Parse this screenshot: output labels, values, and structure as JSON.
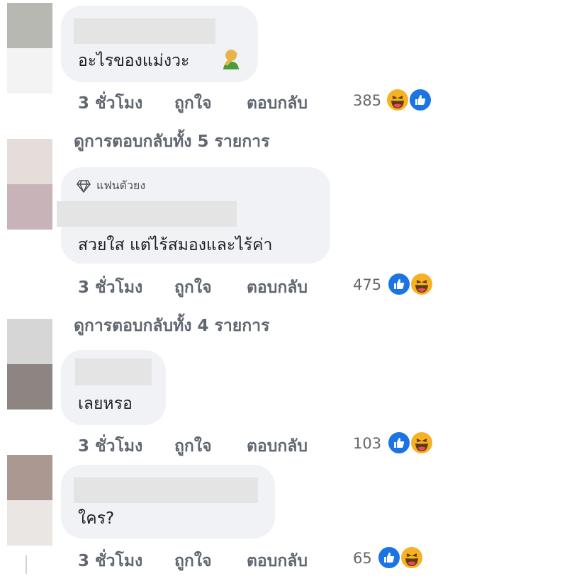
{
  "comments": [
    {
      "text": "อะไรของแม่งวะ",
      "actions": {
        "time": "3 ชั่วโมง",
        "like": "ถูกใจ",
        "reply": "ตอบกลับ"
      },
      "reaction_count": "385",
      "reactions": [
        "haha",
        "like"
      ]
    },
    {
      "badge": "แฟนตัวยง",
      "text": "สวยใส แต่ไร้สมองและไร้ค่า",
      "actions": {
        "time": "3 ชั่วโมง",
        "like": "ถูกใจ",
        "reply": "ตอบกลับ"
      },
      "reaction_count": "475",
      "reactions": [
        "like",
        "haha"
      ]
    },
    {
      "text": "เลยหรอ",
      "actions": {
        "time": "3 ชั่วโมง",
        "like": "ถูกใจ",
        "reply": "ตอบกลับ"
      },
      "reaction_count": "103",
      "reactions": [
        "like",
        "haha"
      ]
    },
    {
      "text": "ใคร?",
      "actions": {
        "time": "3 ชั่วโมง",
        "like": "ถูกใจ",
        "reply": "ตอบกลับ"
      },
      "reaction_count": "65",
      "reactions": [
        "like",
        "haha"
      ]
    }
  ],
  "view_replies": [
    "ดูการตอบกลับทั้ง 5 รายการ",
    "ดูการตอบกลับทั้ง 4 รายการ"
  ],
  "colors": {
    "bubble": "#f0f2f5",
    "like": "#1b74e4",
    "haha": "#f7b125",
    "action_text": "#606770"
  }
}
